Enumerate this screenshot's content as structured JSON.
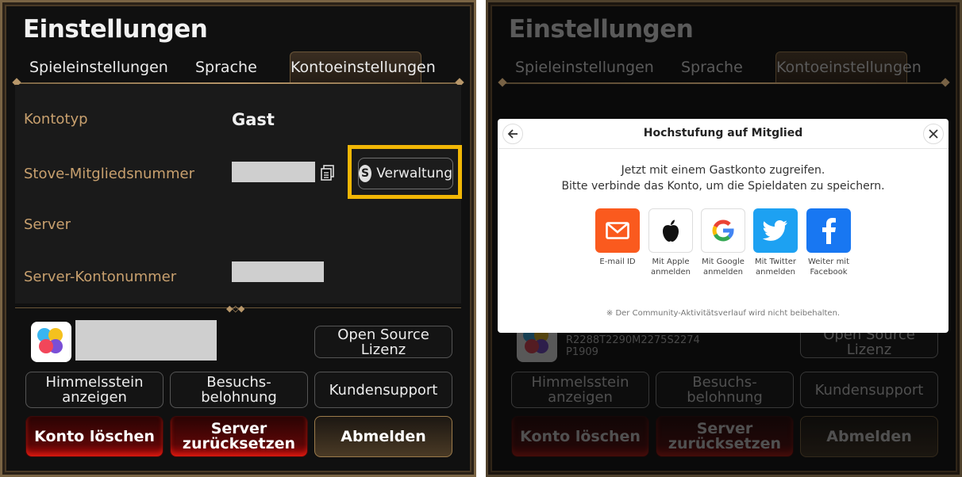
{
  "settings": {
    "title": "Einstellungen",
    "tabs": [
      {
        "label": "Spieleinstellungen"
      },
      {
        "label": "Sprache"
      },
      {
        "label": "Kontoeinstellungen"
      }
    ],
    "rows": {
      "account_type_label": "Kontotyp",
      "account_type_value": "Gast",
      "member_no_label": "Stove-Mitgliedsnummer",
      "server_label": "Server",
      "server_account_label": "Server-Kontonummer"
    },
    "manage_button": "Verwaltung",
    "manage_icon_letter": "S",
    "buttons": {
      "open_source": "Open Source Lizenz",
      "skystone": "Himmelsstein anzeigen",
      "visit_reward": "Besuchs-belohnung",
      "support": "Kundensupport",
      "delete_account": "Konto löschen",
      "reset_server": "Server zurücksetzen",
      "logout": "Abmelden"
    }
  },
  "right_background": {
    "account_id_line1": "R2288T2290M2275S2274",
    "account_id_line2": "P1909"
  },
  "modal": {
    "title": "Hochstufung auf Mitglied",
    "line1": "Jetzt mit einem Gastkonto zugreifen.",
    "line2": "Bitte verbinde das Konto, um die Spieldaten zu speichern.",
    "options": [
      {
        "label1": "E-mail ID",
        "label2": "",
        "icon": "mail-icon",
        "color": "#fa5a1e"
      },
      {
        "label1": "Mit Apple",
        "label2": "anmelden",
        "icon": "apple-icon",
        "color": "#ffffff"
      },
      {
        "label1": "Mit Google",
        "label2": "anmelden",
        "icon": "google-icon",
        "color": "#ffffff"
      },
      {
        "label1": "Mit Twitter",
        "label2": "anmelden",
        "icon": "twitter-icon",
        "color": "#1da1f2"
      },
      {
        "label1": "Weiter mit",
        "label2": "Facebook",
        "icon": "facebook-icon",
        "color": "#1877f2"
      }
    ],
    "footnote": "※ Der Community-Aktivitätsverlauf wird nicht beibehalten."
  },
  "colors": {
    "highlight": "#f2b705",
    "label_gold": "#c8a06e",
    "frame": "#7a6444"
  }
}
